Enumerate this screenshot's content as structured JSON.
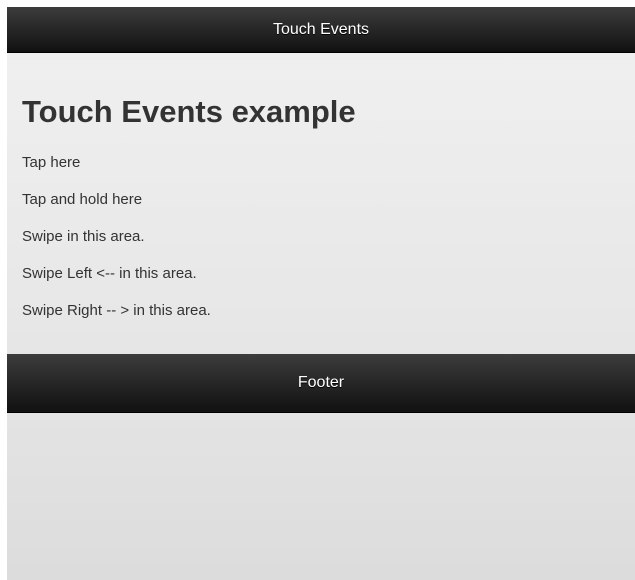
{
  "header": {
    "title": "Touch Events"
  },
  "main": {
    "heading": "Touch Events example",
    "items": [
      "Tap here",
      "Tap and hold here",
      "Swipe in this area.",
      "Swipe Left <-- in this area.",
      "Swipe Right -- > in this area."
    ]
  },
  "footer": {
    "title": "Footer"
  },
  "colors": {
    "bar": "#111111",
    "bar_text": "#ffffff",
    "page_bg": "#e9e9e9",
    "text": "#333333"
  }
}
